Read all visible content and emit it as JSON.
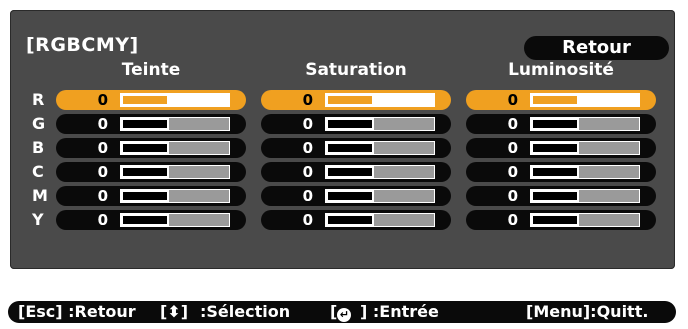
{
  "panel": {
    "title": "[RGBCMY]",
    "back_label": "Retour"
  },
  "columns": [
    {
      "label": "Teinte"
    },
    {
      "label": "Saturation"
    },
    {
      "label": "Luminosité"
    }
  ],
  "rows": [
    {
      "label": "R",
      "values": [
        "0",
        "0",
        "0"
      ],
      "selected": true
    },
    {
      "label": "G",
      "values": [
        "0",
        "0",
        "0"
      ],
      "selected": false
    },
    {
      "label": "B",
      "values": [
        "0",
        "0",
        "0"
      ],
      "selected": false
    },
    {
      "label": "C",
      "values": [
        "0",
        "0",
        "0"
      ],
      "selected": false
    },
    {
      "label": "M",
      "values": [
        "0",
        "0",
        "0"
      ],
      "selected": false
    },
    {
      "label": "Y",
      "values": [
        "0",
        "0",
        "0"
      ],
      "selected": false
    }
  ],
  "slider_level": 0.5,
  "colors": {
    "accent": "#f0a020",
    "panel_bg": "#4a4a4a",
    "pill_bg": "#0a0a0a"
  },
  "footer": {
    "esc": "[Esc] :Retour",
    "select": ":Sélection",
    "select_key": "[⬍]",
    "enter_key_open": "[",
    "enter_icon": "enter-icon",
    "enter": "] :Entrée",
    "menu": "[Menu]:Quitt."
  }
}
